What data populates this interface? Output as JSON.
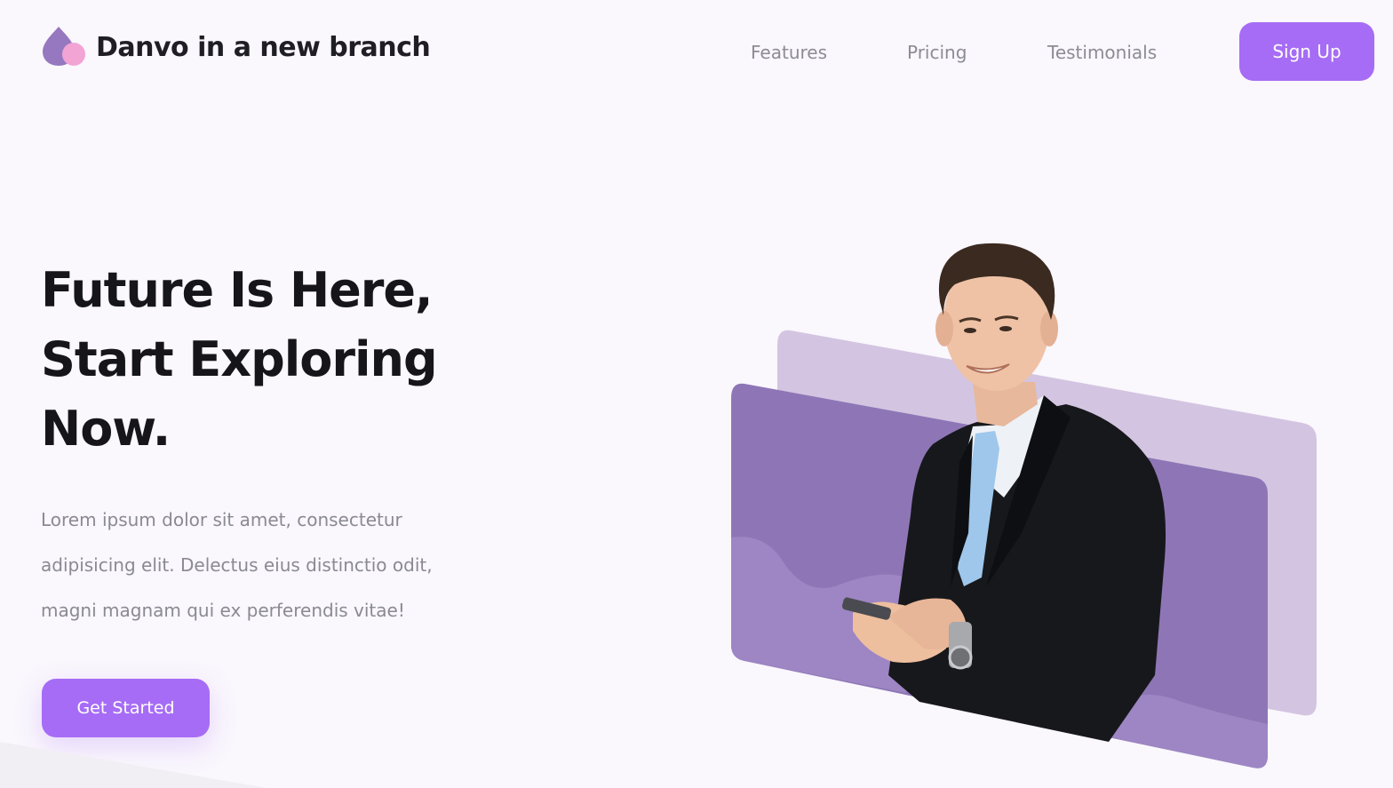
{
  "brand": {
    "name": "Danvo in a new branch",
    "logo_icon": "droplet-logo-icon"
  },
  "nav": {
    "links": [
      {
        "label": "Features"
      },
      {
        "label": "Pricing"
      },
      {
        "label": "Testimonials"
      }
    ],
    "signup_label": "Sign Up"
  },
  "hero": {
    "title_lines": [
      "Future Is Here,",
      "Start Exploring",
      "Now."
    ],
    "description_lines": [
      "Lorem ipsum dolor sit amet, consectetur",
      "adipisicing elit. Delectus eius distinctio odit,",
      "magni magnam qui ex perferendis vitae!"
    ],
    "cta_label": "Get Started"
  },
  "colors": {
    "accent": "#a66cf5",
    "panel_dark": "#8e76b6",
    "panel_light": "#d3c5e1",
    "title": "#16161a",
    "muted": "#8a8a92"
  },
  "illustration": {
    "subject": "businessman-with-phone-image"
  }
}
